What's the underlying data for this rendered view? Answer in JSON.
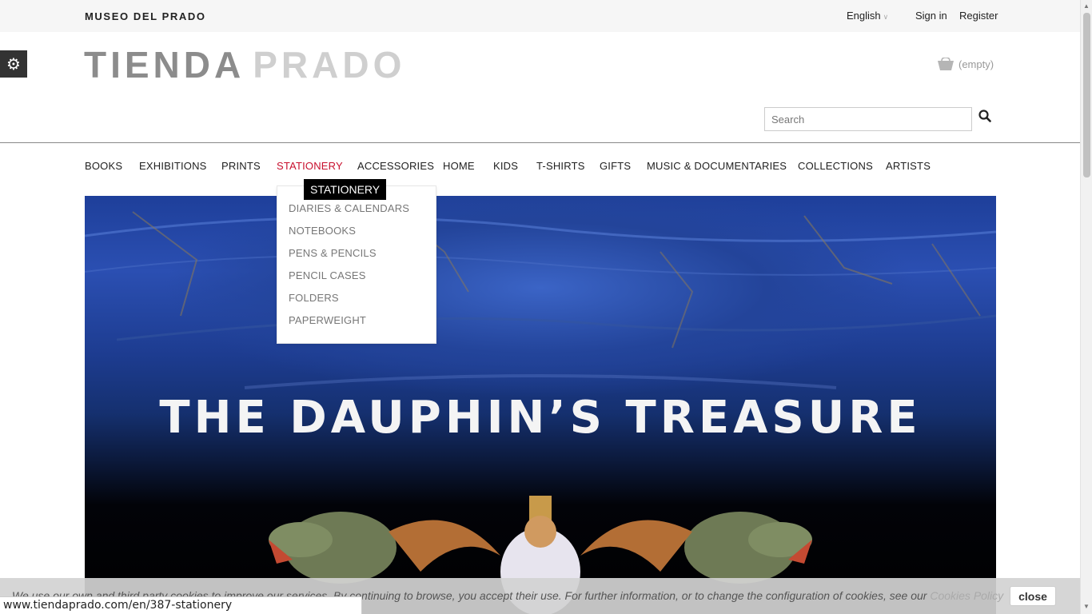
{
  "topbar": {
    "brand": "MUSEO DEL PRADO",
    "language": "English",
    "sign_in": "Sign in",
    "register": "Register"
  },
  "logo": {
    "word1": "TIENDA",
    "word2": "PRADO"
  },
  "cart": {
    "label": "(empty)"
  },
  "search": {
    "placeholder": "Search"
  },
  "nav": {
    "items": [
      {
        "label": "BOOKS"
      },
      {
        "label": "EXHIBITIONS"
      },
      {
        "label": "PRINTS"
      },
      {
        "label": "STATIONERY",
        "active": true
      },
      {
        "label": "ACCESSORIES"
      },
      {
        "label": "HOME"
      },
      {
        "label": "KIDS"
      },
      {
        "label": "T-SHIRTS"
      },
      {
        "label": "GIFTS"
      },
      {
        "label": "MUSIC & DOCUMENTARIES"
      },
      {
        "label": "COLLECTIONS"
      },
      {
        "label": "ARTISTS"
      }
    ]
  },
  "dropdown": {
    "tooltip": "STATIONERY",
    "items": [
      "DIARIES & CALENDARS",
      "NOTEBOOKS",
      "PENS & PENCILS",
      "PENCIL CASES",
      "FOLDERS",
      "PAPERWEIGHT"
    ]
  },
  "hero": {
    "title": "THE DAUPHIN’S TREASURE"
  },
  "cookies": {
    "text": "We use our own and third party cookies to improve our services. By continuing to browse, you accept their use. For further information, or to change the configuration of cookies, see our",
    "link": "Cookies Policy",
    "close": "close"
  },
  "statusbar": {
    "url": "www.tiendaprado.com/en/387-stationery"
  },
  "colors": {
    "accent": "#c8102e",
    "hero_blue": "#2b4fb2",
    "logo_dark": "#8c8c8c",
    "logo_light": "#cfcfcf"
  },
  "icons": {
    "settings": "gear-icon",
    "cart": "cart-icon",
    "search": "search-icon",
    "language": "chevron-down-icon"
  }
}
